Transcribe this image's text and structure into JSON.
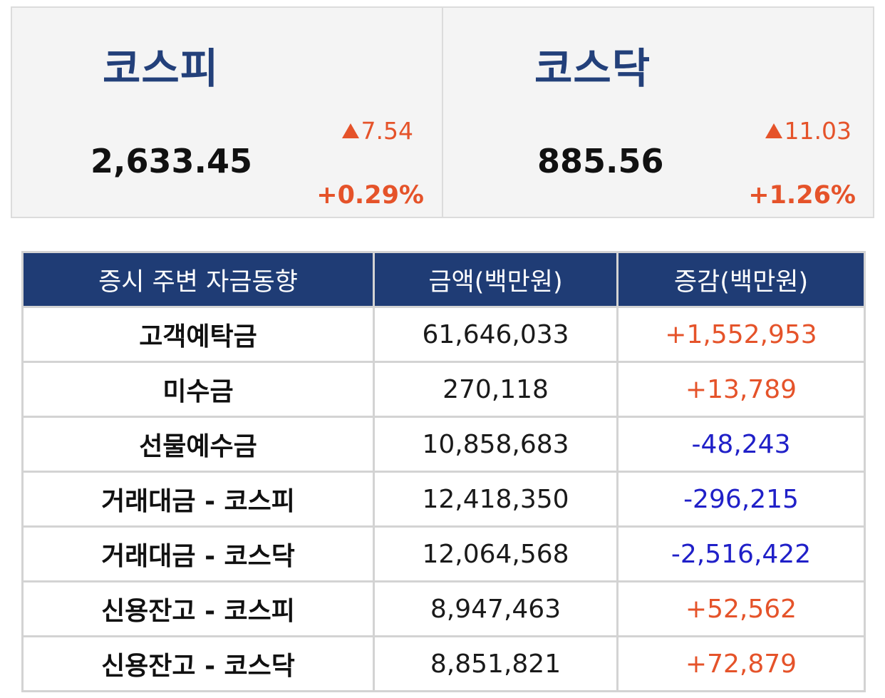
{
  "indices": [
    {
      "name": "코스피",
      "value": "2,633.45",
      "change": "7.54",
      "change_pct": "+0.29%",
      "direction_icon": "up-triangle-icon"
    },
    {
      "name": "코스닥",
      "value": "885.56",
      "change": "11.03",
      "change_pct": "+1.26%",
      "direction_icon": "up-triangle-icon"
    }
  ],
  "table": {
    "headers": [
      "증시 주변 자금동향",
      "금액(백만원)",
      "증감(백만원)"
    ],
    "rows": [
      {
        "label": "고객예탁금",
        "amount": "61,646,033",
        "delta": "+1,552,953"
      },
      {
        "label": "미수금",
        "amount": "270,118",
        "delta": "+13,789"
      },
      {
        "label": "선물예수금",
        "amount": "10,858,683",
        "delta": "-48,243"
      },
      {
        "label": "거래대금 - 코스피",
        "amount": "12,418,350",
        "delta": "-296,215"
      },
      {
        "label": "거래대금 - 코스닥",
        "amount": "12,064,568",
        "delta": "-2,516,422"
      },
      {
        "label": "신용잔고 - 코스피",
        "amount": "8,947,463",
        "delta": "+52,562"
      },
      {
        "label": "신용잔고 - 코스닥",
        "amount": "8,851,821",
        "delta": "+72,879"
      }
    ]
  },
  "colors": {
    "up": "#e5532a",
    "down": "#2020c8",
    "header_bg": "#1f3c75",
    "index_name": "#23407a"
  }
}
